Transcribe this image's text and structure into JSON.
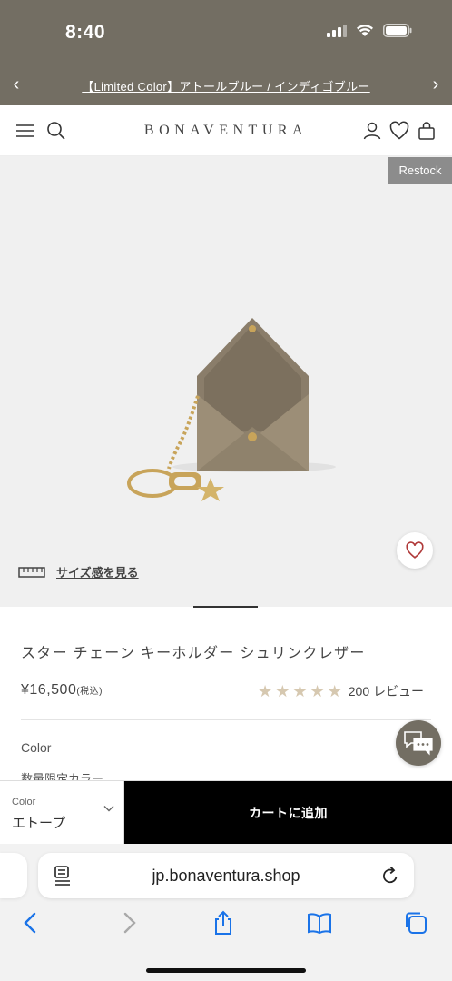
{
  "status": {
    "time": "8:40"
  },
  "announcement": {
    "text": "【Limited Color】アトールブルー / インディゴブルー"
  },
  "header": {
    "logo": "BONAVENTURA"
  },
  "gallery": {
    "badge": "Restock",
    "size_link": "サイズ感を見る"
  },
  "product": {
    "title": "スター チェーン キーホルダー シュリンクレザー",
    "price": "¥16,500",
    "price_tax": "(税込)",
    "rating": 5,
    "review_count": "200 レビュー",
    "color_label": "Color",
    "limited_label": "数量限定カラー"
  },
  "cart_bar": {
    "variant_label": "Color",
    "variant_value": "エトープ",
    "add_to_cart": "カートに追加"
  },
  "browser": {
    "url": "jp.bonaventura.shop"
  },
  "colors": {
    "brand_bar": "#736e63",
    "cart_button": "#000000",
    "star": "#d6c8b0",
    "heart": "#b03a3a",
    "ios_blue": "#1a73e8"
  }
}
